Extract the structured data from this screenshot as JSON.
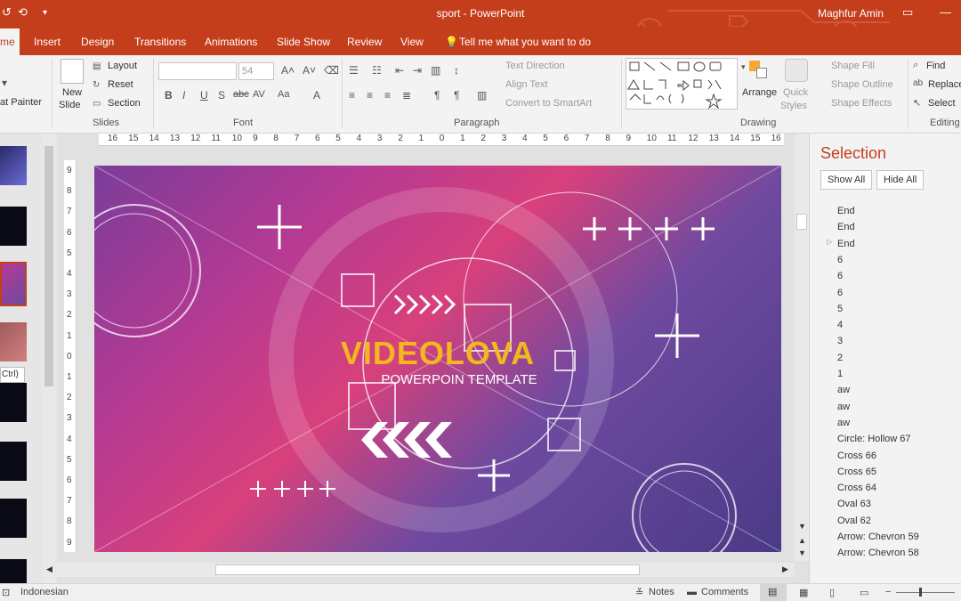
{
  "titlebar": {
    "title": "sport  -  PowerPoint",
    "user": "Maghfur Amin",
    "accent_color": "#c43e1c"
  },
  "tabs": [
    {
      "label": "me"
    },
    {
      "label": "Insert"
    },
    {
      "label": "Design"
    },
    {
      "label": "Transitions"
    },
    {
      "label": "Animations"
    },
    {
      "label": "Slide Show"
    },
    {
      "label": "Review"
    },
    {
      "label": "View"
    }
  ],
  "tell_me": "Tell me what you want to do",
  "ribbon": {
    "clipboard": {
      "painter": "at Painter"
    },
    "slides": {
      "new": "New",
      "new2": "Slide",
      "layout": "Layout",
      "reset": "Reset",
      "section": "Section",
      "label": "Slides"
    },
    "font": {
      "size": "54",
      "label": "Font"
    },
    "paragraph": {
      "text_direction": "Text Direction",
      "align_text": "Align Text",
      "convert": "Convert to SmartArt",
      "label": "Paragraph"
    },
    "drawing": {
      "arrange": "Arrange",
      "quick": "Quick",
      "styles": "Styles",
      "shape_fill": "Shape Fill",
      "shape_outline": "Shape Outline",
      "shape_effects": "Shape Effects",
      "label": "Drawing"
    },
    "editing": {
      "find": "Find",
      "replace": "Replace",
      "select": "Select",
      "label": "Editing"
    }
  },
  "thumbs": {
    "ctrl_badge": "Ctrl)"
  },
  "ruler": {
    "h": [
      "16",
      "15",
      "14",
      "13",
      "12",
      "11",
      "10",
      "9",
      "8",
      "7",
      "6",
      "5",
      "4",
      "3",
      "2",
      "1",
      "0",
      "1",
      "2",
      "3",
      "4",
      "5",
      "6",
      "7",
      "8",
      "9",
      "10",
      "11",
      "12",
      "13",
      "14",
      "15",
      "16"
    ],
    "v": [
      "9",
      "8",
      "7",
      "6",
      "5",
      "4",
      "3",
      "2",
      "1",
      "0",
      "1",
      "2",
      "3",
      "4",
      "5",
      "6",
      "7",
      "8",
      "9"
    ]
  },
  "slide": {
    "title": "VIDEOLOVA",
    "subtitle": "POWERPOIN TEMPLATE",
    "title_color": "#f2b81d"
  },
  "selection": {
    "title": "Selection",
    "show_all": "Show All",
    "hide_all": "Hide All",
    "items": [
      "End",
      "End",
      "End",
      "6",
      "6",
      "6",
      "5",
      "4",
      "3",
      "2",
      "1",
      "aw",
      "aw",
      "aw",
      "Circle: Hollow 67",
      "Cross 66",
      "Cross 65",
      "Cross 64",
      "Oval 63",
      "Oval 62",
      "Arrow: Chevron 59",
      "Arrow: Chevron 58"
    ]
  },
  "status": {
    "language": "Indonesian",
    "notes": "Notes",
    "comments": "Comments"
  }
}
